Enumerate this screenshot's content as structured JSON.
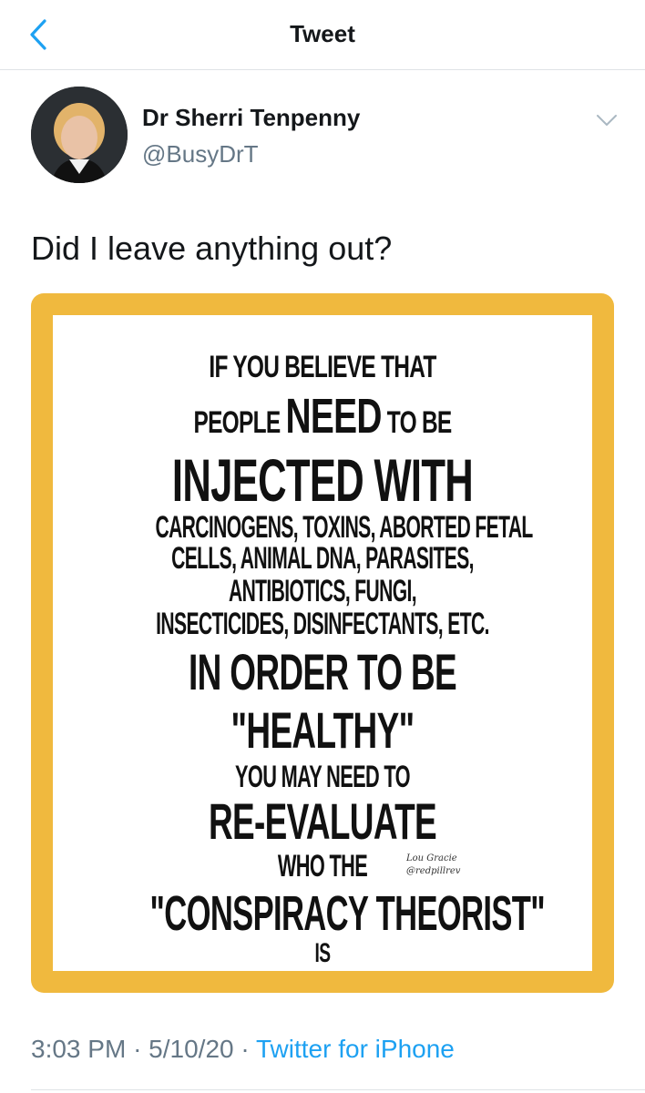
{
  "nav": {
    "title": "Tweet",
    "back_icon": "chevron-left-icon",
    "accent": "#1da1f2"
  },
  "author": {
    "name": "Dr Sherri Tenpenny",
    "handle": "@BusyDrT",
    "menu_icon": "chevron-down-icon"
  },
  "tweet": {
    "text": "Did I leave anything out?",
    "time": "3:03 PM",
    "separator": "·",
    "date": "5/10/20",
    "source": "Twitter for iPhone"
  },
  "media": {
    "border_color": "#f0b93e",
    "poster_lines": {
      "l1": "IF YOU BELIEVE THAT",
      "l2a": "PEOPLE",
      "l2b": "NEED",
      "l2c": "TO BE",
      "l3": "INJECTED WITH",
      "l4": "CARCINOGENS, TOXINS, ABORTED FETAL",
      "l5": "CELLS, ANIMAL DNA, PARASITES,",
      "l6": "ANTIBIOTICS, FUNGI,",
      "l7": "INSECTICIDES, DISINFECTANTS, ETC.",
      "l8": "IN ORDER TO BE",
      "l9": "\"HEALTHY\"",
      "l10": "YOU MAY NEED TO",
      "l11": "RE-EVALUATE",
      "l12": "WHO THE",
      "l13": "\"CONSPIRACY THEORIST\"",
      "l14": "IS"
    },
    "signature": {
      "name": "Lou Gracie",
      "handle": "@redpillrev"
    }
  }
}
